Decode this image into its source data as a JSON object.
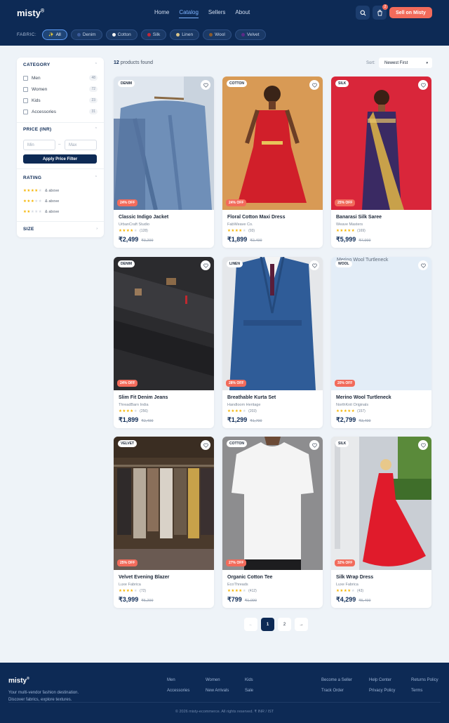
{
  "header": {
    "logo": "misty",
    "logo_mark": "®",
    "nav": [
      "Home",
      "Catalog",
      "Sellers",
      "About"
    ],
    "active_nav": "Catalog",
    "cart_count": "2",
    "sell_label": "Sell on Misty"
  },
  "fabric_filter": {
    "label": "FABRIC:",
    "chips": [
      {
        "label": "All",
        "icon": "sparkles-icon",
        "glyph": "✨",
        "active": true
      },
      {
        "label": "Denim",
        "color": "#3b5b9a"
      },
      {
        "label": "Cotton",
        "color": "#f4f4f4"
      },
      {
        "label": "Silk",
        "color": "#c0283a"
      },
      {
        "label": "Linen",
        "color": "#d9c48a"
      },
      {
        "label": "Wool",
        "color": "#8a5a2b"
      },
      {
        "label": "Velvet",
        "color": "#5b2a86"
      }
    ]
  },
  "sidebar": {
    "category_title": "CATEGORY",
    "categories": [
      {
        "label": "Men",
        "count": "48"
      },
      {
        "label": "Women",
        "count": "72"
      },
      {
        "label": "Kids",
        "count": "23"
      },
      {
        "label": "Accessories",
        "count": "31"
      }
    ],
    "price_title": "PRICE (INR)",
    "min_placeholder": "Min",
    "max_placeholder": "Max",
    "price_sep": "–",
    "apply_label": "Apply Price Filter",
    "rating_title": "RATING",
    "ratings": [
      {
        "stars": 4,
        "label": "& above"
      },
      {
        "stars": 3,
        "label": "& above"
      },
      {
        "stars": 2,
        "label": "& above"
      }
    ],
    "size_title": "SIZE"
  },
  "toolbar": {
    "count": "12",
    "count_suffix": "products found",
    "sort_label": "Sort:",
    "sort_value": "Newest First"
  },
  "products": [
    {
      "fabric": "DENIM",
      "discount": "24% OFF",
      "name": "Classic Indigo Jacket",
      "brand": "UrbanCraft Studio",
      "stars": 4,
      "reviews": "(128)",
      "price": "₹2,499",
      "mrp": "₹3,299"
    },
    {
      "fabric": "COTTON",
      "discount": "24% OFF",
      "name": "Floral Cotton Maxi Dress",
      "brand": "FabWeave Co.",
      "stars": 4,
      "reviews": "(93)",
      "price": "₹1,899",
      "mrp": "₹2,499"
    },
    {
      "fabric": "SILK",
      "discount": "25% OFF",
      "name": "Banarasi Silk Saree",
      "brand": "Weave Masters",
      "stars": 5,
      "reviews": "(169)",
      "price": "₹5,999",
      "mrp": "₹7,999"
    },
    {
      "fabric": "DENIM",
      "discount": "24% OFF",
      "name": "Slim Fit Denim Jeans",
      "brand": "ThreadBarn India",
      "stars": 4,
      "reviews": "(256)",
      "price": "₹1,899",
      "mrp": "₹2,499"
    },
    {
      "fabric": "LINEN",
      "discount": "28% OFF",
      "name": "Breathable Kurta Set",
      "brand": "Handloom Heritage",
      "stars": 4,
      "reviews": "(203)",
      "price": "₹1,299",
      "mrp": "₹1,799"
    },
    {
      "fabric": "WOOL",
      "discount": "20% OFF",
      "name": "Merino Wool Turtleneck",
      "brand": "NorthKnit Originals",
      "stars": 5,
      "reviews": "(157)",
      "price": "₹2,799",
      "mrp": "₹3,499",
      "img_alt": "Merino Wool Turtleneck"
    },
    {
      "fabric": "VELVET",
      "discount": "25% OFF",
      "name": "Velvet Evening Blazer",
      "brand": "Luxe Fabrica",
      "stars": 4,
      "reviews": "(72)",
      "price": "₹3,999",
      "mrp": "₹5,299"
    },
    {
      "fabric": "COTTON",
      "discount": "27% OFF",
      "name": "Organic Cotton Tee",
      "brand": "EcoThreads",
      "stars": 4,
      "reviews": "(412)",
      "price": "₹799",
      "mrp": "₹1,099"
    },
    {
      "fabric": "SILK",
      "discount": "32% OFF",
      "name": "Silk Wrap Dress",
      "brand": "Luxe Fabrica",
      "stars": 4,
      "reviews": "(43)",
      "price": "₹4,299",
      "mrp": "₹5,499"
    }
  ],
  "pagination": {
    "prev": "←",
    "pages": [
      "1",
      "2"
    ],
    "next": "→",
    "active": "1"
  },
  "footer": {
    "logo": "misty",
    "logo_mark": "®",
    "tagline_1": "Your multi-vendor fashion destination.",
    "tagline_2": "Discover fabrics, explore textures.",
    "links": [
      "Men",
      "Women",
      "Kids",
      "Accessories",
      "New Arrivals",
      "Sale",
      "Become a Seller",
      "Help Center",
      "Returns Policy",
      "Track Order",
      "Privacy Policy",
      "Terms"
    ],
    "copyright": "© 2026 misty-ecommerce. All rights reserved. ₹ INR / IST"
  },
  "colors": {
    "primary": "#0d2a55",
    "accent": "#f26b5b",
    "link": "#7fb4ff",
    "star": "#f5b400"
  }
}
